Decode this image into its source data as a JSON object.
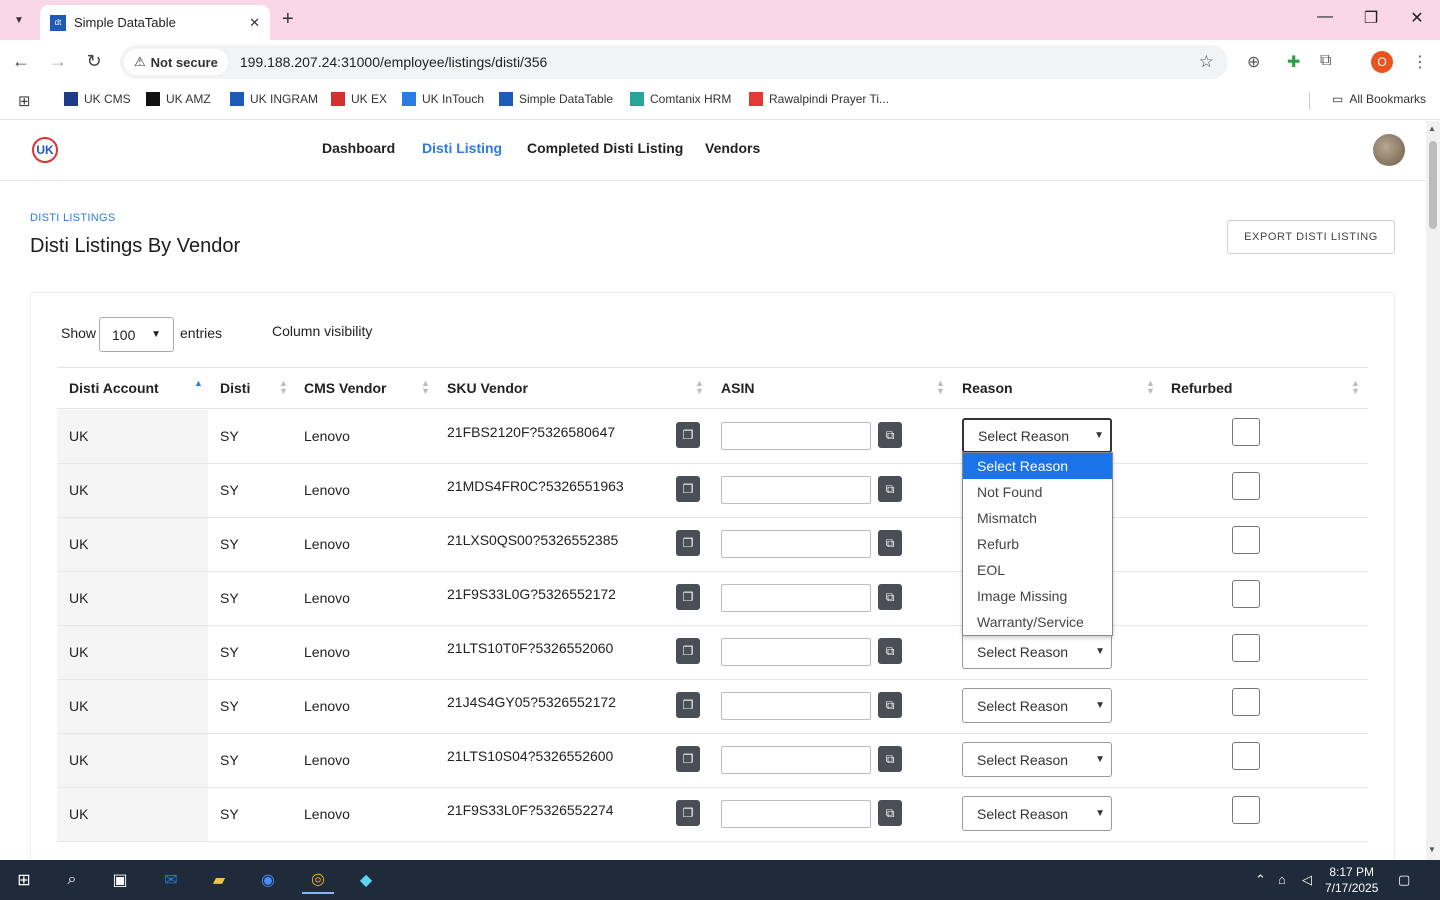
{
  "browser": {
    "tab_title": "Simple DataTable",
    "tab_favicon_text": "dt",
    "secure_label": "Not secure",
    "url": "199.188.207.24:31000/employee/listings/disti/356",
    "profile_letter": "O",
    "bookmarks": [
      {
        "label": "UK CMS",
        "color": "#1e3a8a"
      },
      {
        "label": "UK AMZ",
        "color": "#111111"
      },
      {
        "label": "UK INGRAM",
        "color": "#1e5bb8"
      },
      {
        "label": "UK EX",
        "color": "#d32f2f"
      },
      {
        "label": "UK InTouch",
        "color": "#2c7be5"
      },
      {
        "label": "Simple DataTable",
        "color": "#1e5bb8"
      },
      {
        "label": "Comtanix HRM",
        "color": "#26a69a"
      },
      {
        "label": "Rawalpindi Prayer Ti...",
        "color": "#e53935"
      }
    ],
    "all_bookmarks": "All Bookmarks"
  },
  "app": {
    "logo_text": "UK",
    "nav": [
      "Dashboard",
      "Disti Listing",
      "Completed Disti Listing",
      "Vendors"
    ],
    "active_nav": "Disti Listing"
  },
  "page": {
    "breadcrumb": "DISTI LISTINGS",
    "title": "Disti Listings By Vendor",
    "export_label": "EXPORT DISTI LISTING"
  },
  "table_controls": {
    "show_label": "Show",
    "page_length": "100",
    "entries_label": "entries",
    "column_visibility": "Column visibility"
  },
  "table": {
    "columns": [
      "Disti Account",
      "Disti",
      "CMS Vendor",
      "SKU Vendor",
      "ASIN",
      "Reason",
      "Refurbed"
    ],
    "reason_placeholder": "Select Reason",
    "rows": [
      {
        "account": "UK",
        "disti": "SY",
        "vendor": "Lenovo",
        "sku": "21FBS2120F?5326580647"
      },
      {
        "account": "UK",
        "disti": "SY",
        "vendor": "Lenovo",
        "sku": "21MDS4FR0C?5326551963"
      },
      {
        "account": "UK",
        "disti": "SY",
        "vendor": "Lenovo",
        "sku": "21LXS0QS00?5326552385"
      },
      {
        "account": "UK",
        "disti": "SY",
        "vendor": "Lenovo",
        "sku": "21F9S33L0G?5326552172"
      },
      {
        "account": "UK",
        "disti": "SY",
        "vendor": "Lenovo",
        "sku": "21LTS10T0F?5326552060"
      },
      {
        "account": "UK",
        "disti": "SY",
        "vendor": "Lenovo",
        "sku": "21J4S4GY05?5326552172"
      },
      {
        "account": "UK",
        "disti": "SY",
        "vendor": "Lenovo",
        "sku": "21LTS10S04?5326552600"
      },
      {
        "account": "UK",
        "disti": "SY",
        "vendor": "Lenovo",
        "sku": "21F9S33L0F?5326552274"
      }
    ]
  },
  "reason_dropdown": {
    "options": [
      "Select Reason",
      "Not Found",
      "Mismatch",
      "Refurb",
      "EOL",
      "Image Missing",
      "Warranty/Service"
    ],
    "selected": "Select Reason"
  },
  "taskbar": {
    "time": "8:17 PM",
    "date": "7/17/2025"
  },
  "colors": {
    "accent": "#2c7be5",
    "dropdown_selected": "#1a73e8",
    "tabstrip": "#f9d7e6",
    "taskbar": "#1f2b3a"
  }
}
